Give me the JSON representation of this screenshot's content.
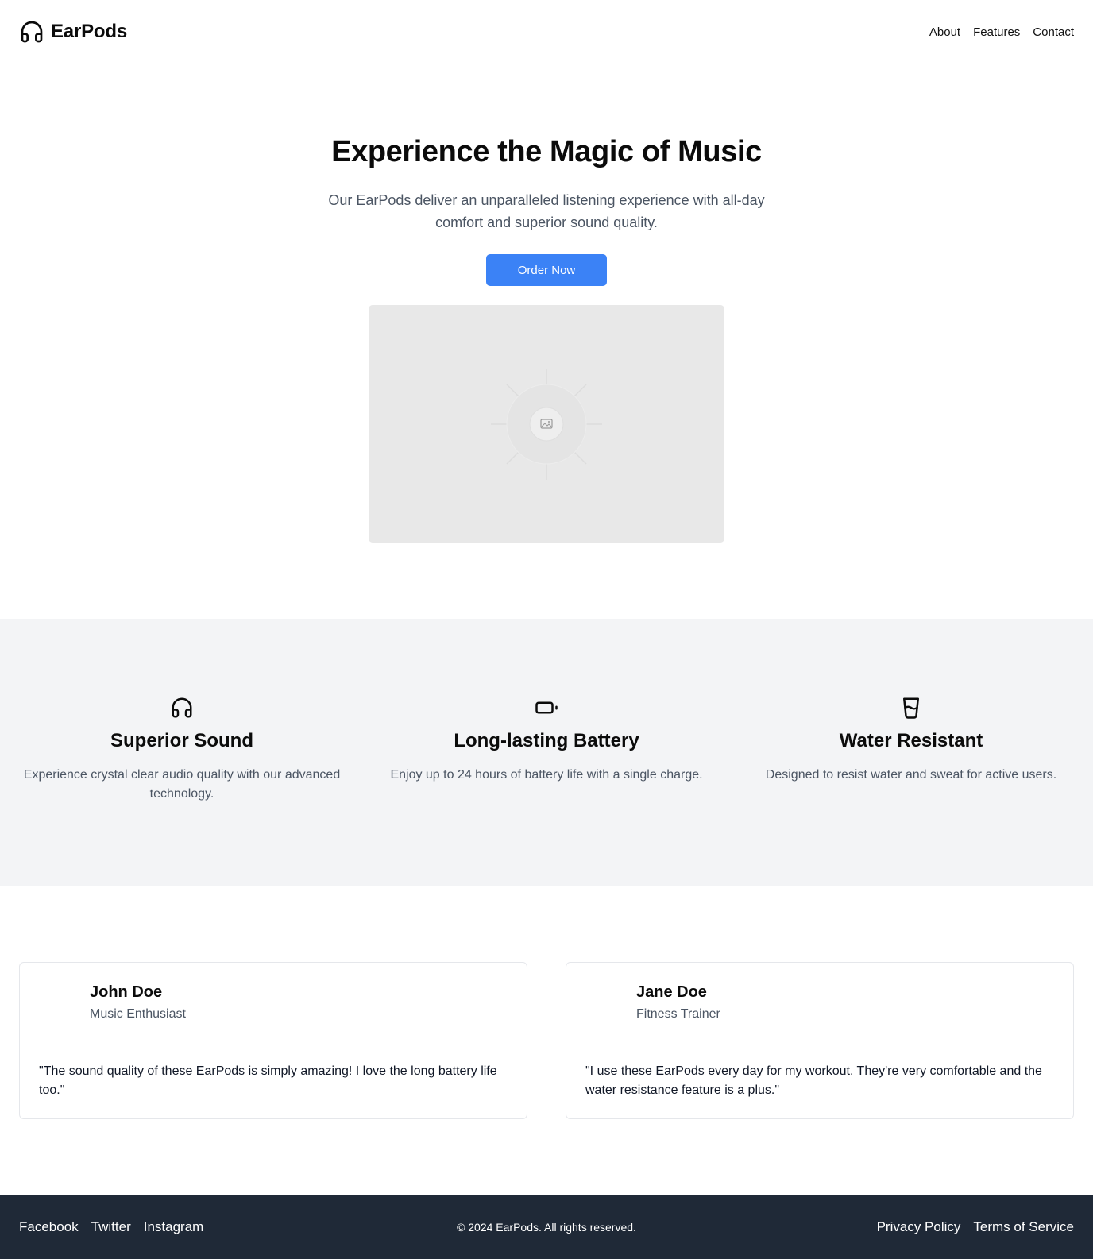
{
  "header": {
    "brand": "EarPods",
    "logo_icon": "headphones-icon",
    "nav": [
      "About",
      "Features",
      "Contact"
    ]
  },
  "hero": {
    "title": "Experience the Magic of Music",
    "subtitle": "Our EarPods deliver an unparalleled listening experience with all-day comfort and superior sound quality.",
    "cta_label": "Order Now",
    "image_icon": "image-placeholder-icon"
  },
  "features": [
    {
      "icon": "headphones-icon",
      "title": "Superior Sound",
      "text": "Experience crystal clear audio quality with our advanced technology."
    },
    {
      "icon": "battery-icon",
      "title": "Long-lasting Battery",
      "text": "Enjoy up to 24 hours of battery life with a single charge."
    },
    {
      "icon": "glass-water-icon",
      "title": "Water Resistant",
      "text": "Designed to resist water and sweat for active users."
    }
  ],
  "testimonials": [
    {
      "name": "John Doe",
      "role": "Music Enthusiast",
      "quote": "\"The sound quality of these EarPods is simply amazing! I love the long battery life too.\""
    },
    {
      "name": "Jane Doe",
      "role": "Fitness Trainer",
      "quote": "\"I use these EarPods every day for my workout. They're very comfortable and the water resistance feature is a plus.\""
    }
  ],
  "footer": {
    "social": [
      "Facebook",
      "Twitter",
      "Instagram"
    ],
    "copyright": "© 2024 EarPods. All rights reserved.",
    "legal": [
      "Privacy Policy",
      "Terms of Service"
    ]
  },
  "colors": {
    "accent": "#3b82f6",
    "features_bg": "#f3f4f6",
    "footer_bg": "#1f2937"
  }
}
